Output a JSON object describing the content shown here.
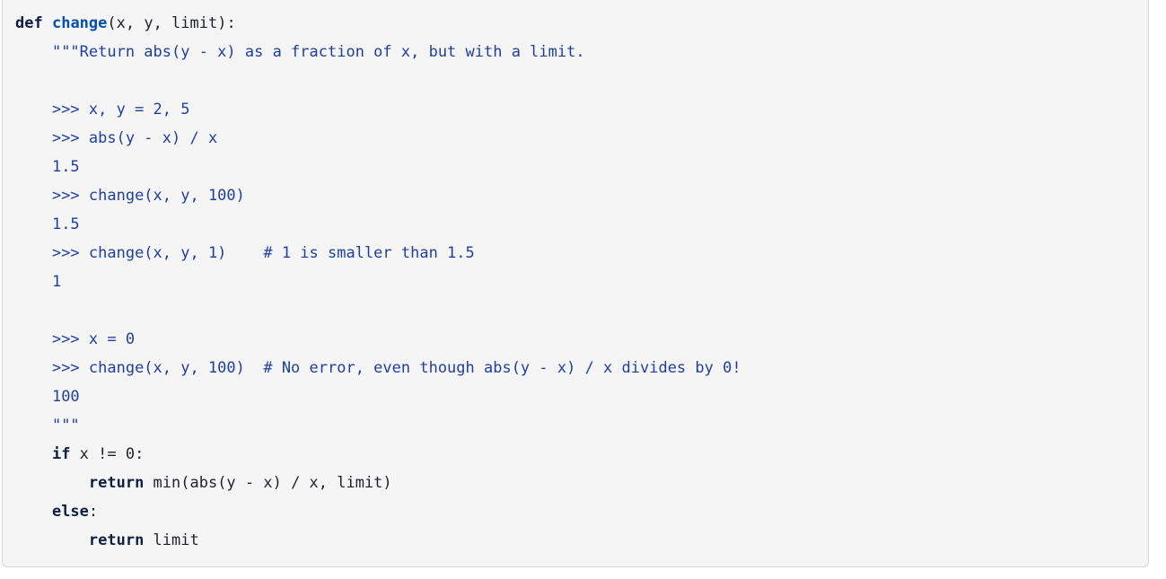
{
  "code_block": {
    "language": "python",
    "background_color": "#f5f5f5",
    "border_color": "#d6d6d6",
    "colors": {
      "keyword": "#0d1f44",
      "function_name": "#0550ae",
      "docstring": "#1f3f9e",
      "plain": "#1f2328"
    },
    "plain_text": "def change(x, y, limit):\n    \"\"\"Return abs(y - x) as a fraction of x, but with a limit.\n\n    >>> x, y = 2, 5\n    >>> abs(y - x) / x\n    1.5\n    >>> change(x, y, 100)\n    1.5\n    >>> change(x, y, 1)    # 1 is smaller than 1.5\n    1\n\n    >>> x = 0\n    >>> change(x, y, 100)  # No error, even though abs(y - x) / x divides by 0!\n    100\n    \"\"\"\n    if x != 0:\n        return min(abs(y - x) / x, limit)\n    else:\n        return limit",
    "lines": [
      {
        "n": 1,
        "tokens": [
          {
            "t": "def",
            "c": "kw"
          },
          {
            "t": " ",
            "c": "plain"
          },
          {
            "t": "change",
            "c": "fn"
          },
          {
            "t": "(x, y, limit):",
            "c": "plain"
          }
        ]
      },
      {
        "n": 2,
        "tokens": [
          {
            "t": "    ",
            "c": "plain"
          },
          {
            "t": "\"\"\"Return abs(y - x) as a fraction of x, but with a limit.",
            "c": "doc"
          }
        ]
      },
      {
        "n": 3,
        "tokens": []
      },
      {
        "n": 4,
        "tokens": [
          {
            "t": "    ",
            "c": "plain"
          },
          {
            "t": ">>> x, y = 2, 5",
            "c": "doc"
          }
        ]
      },
      {
        "n": 5,
        "tokens": [
          {
            "t": "    ",
            "c": "plain"
          },
          {
            "t": ">>> abs(y - x) / x",
            "c": "doc"
          }
        ]
      },
      {
        "n": 6,
        "tokens": [
          {
            "t": "    ",
            "c": "plain"
          },
          {
            "t": "1.5",
            "c": "doc"
          }
        ]
      },
      {
        "n": 7,
        "tokens": [
          {
            "t": "    ",
            "c": "plain"
          },
          {
            "t": ">>> change(x, y, 100)",
            "c": "doc"
          }
        ]
      },
      {
        "n": 8,
        "tokens": [
          {
            "t": "    ",
            "c": "plain"
          },
          {
            "t": "1.5",
            "c": "doc"
          }
        ]
      },
      {
        "n": 9,
        "tokens": [
          {
            "t": "    ",
            "c": "plain"
          },
          {
            "t": ">>> change(x, y, 1)    # 1 is smaller than 1.5",
            "c": "doc"
          }
        ]
      },
      {
        "n": 10,
        "tokens": [
          {
            "t": "    ",
            "c": "plain"
          },
          {
            "t": "1",
            "c": "doc"
          }
        ]
      },
      {
        "n": 11,
        "tokens": []
      },
      {
        "n": 12,
        "tokens": [
          {
            "t": "    ",
            "c": "plain"
          },
          {
            "t": ">>> x = 0",
            "c": "doc"
          }
        ]
      },
      {
        "n": 13,
        "tokens": [
          {
            "t": "    ",
            "c": "plain"
          },
          {
            "t": ">>> change(x, y, 100)  # No error, even though abs(y - x) / x divides by 0!",
            "c": "doc"
          }
        ]
      },
      {
        "n": 14,
        "tokens": [
          {
            "t": "    ",
            "c": "plain"
          },
          {
            "t": "100",
            "c": "doc"
          }
        ]
      },
      {
        "n": 15,
        "tokens": [
          {
            "t": "    ",
            "c": "plain"
          },
          {
            "t": "\"\"\"",
            "c": "doc"
          }
        ]
      },
      {
        "n": 16,
        "tokens": [
          {
            "t": "    ",
            "c": "plain"
          },
          {
            "t": "if",
            "c": "kw"
          },
          {
            "t": " x != 0:",
            "c": "plain"
          }
        ]
      },
      {
        "n": 17,
        "tokens": [
          {
            "t": "        ",
            "c": "plain"
          },
          {
            "t": "return",
            "c": "kw"
          },
          {
            "t": " min(abs(y - x) / x, limit)",
            "c": "plain"
          }
        ]
      },
      {
        "n": 18,
        "tokens": [
          {
            "t": "    ",
            "c": "plain"
          },
          {
            "t": "else",
            "c": "kw"
          },
          {
            "t": ":",
            "c": "plain"
          }
        ]
      },
      {
        "n": 19,
        "tokens": [
          {
            "t": "        ",
            "c": "plain"
          },
          {
            "t": "return",
            "c": "kw"
          },
          {
            "t": " limit",
            "c": "plain"
          }
        ]
      }
    ]
  }
}
